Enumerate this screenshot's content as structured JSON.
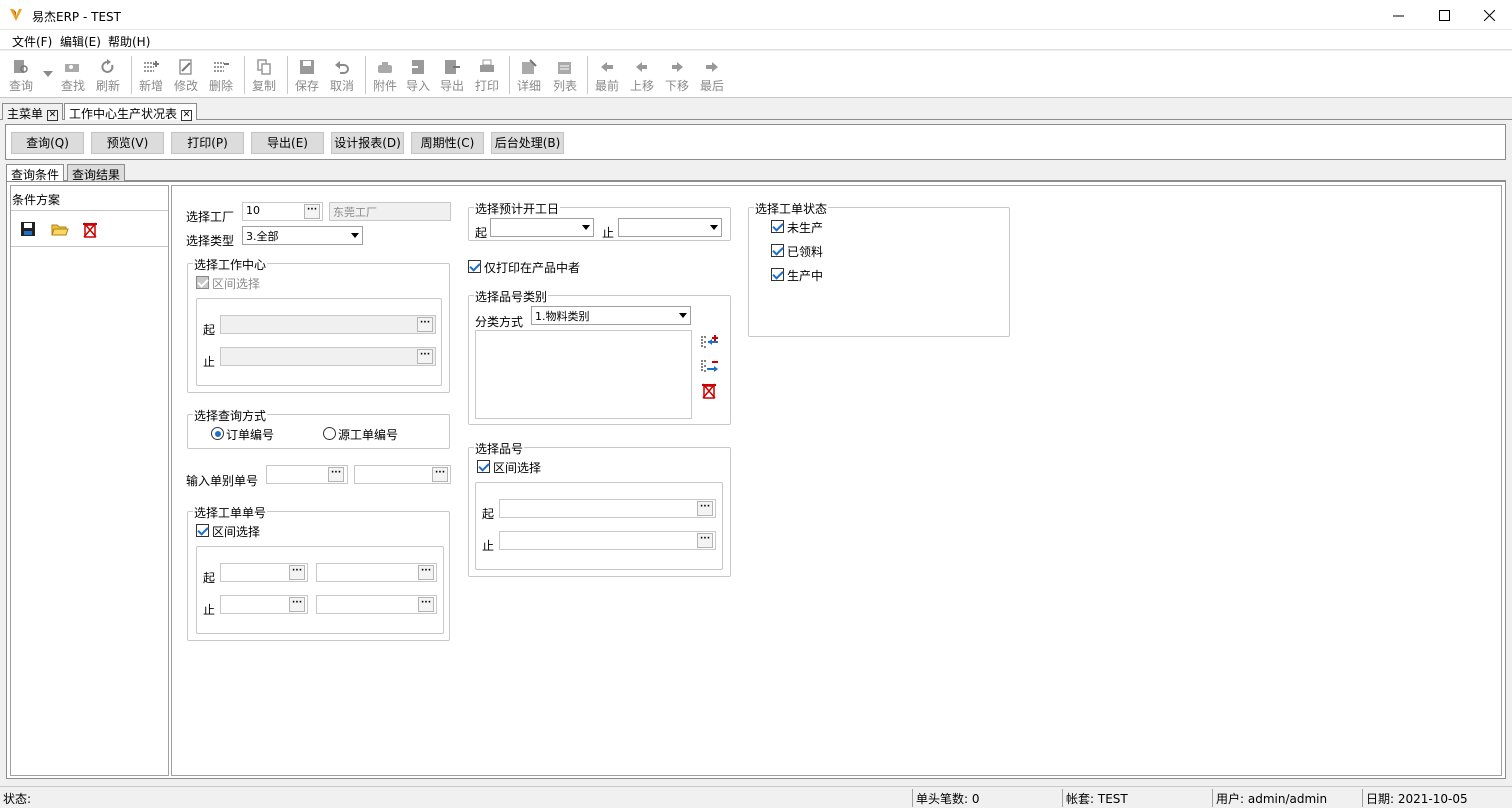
{
  "window": {
    "title": "易杰ERP - TEST"
  },
  "menu": [
    "文件(F)",
    "编辑(E)",
    "帮助(H)"
  ],
  "toolbar": [
    "查询",
    "查找",
    "刷新",
    "新增",
    "修改",
    "删除",
    "复制",
    "保存",
    "取消",
    "附件",
    "导入",
    "导出",
    "打印",
    "详细",
    "列表",
    "最前",
    "上移",
    "下移",
    "最后"
  ],
  "doc_tabs": [
    "主菜单",
    "工作中心生产状况表"
  ],
  "command_buttons": [
    "查询(Q)",
    "预览(V)",
    "打印(P)",
    "导出(E)",
    "设计报表(D)",
    "周期性(C)",
    "后台处理(B)"
  ],
  "sub_tabs": [
    "查询条件",
    "查询结果"
  ],
  "left_panel": {
    "title": "条件方案"
  },
  "form": {
    "factory_label": "选择工厂",
    "factory_code": "10",
    "factory_name": "东莞工厂",
    "type_label": "选择类型",
    "type_value": "3.全部",
    "workcenter": {
      "caption": "选择工作中心",
      "range_label": "区间选择",
      "from_label": "起",
      "to_label": "止"
    },
    "query_mode": {
      "caption": "选择查询方式",
      "opt1": "订单编号",
      "opt2": "源工单编号"
    },
    "doc_no_label": "输入单别单号",
    "wo": {
      "caption": "选择工单单号",
      "range_label": "区间选择",
      "from_label": "起",
      "to_label": "止"
    },
    "start_date": {
      "caption": "选择预计开工日",
      "from_label": "起",
      "to_label": "止"
    },
    "print_only_label": "仅打印在产品中者",
    "item_category": {
      "caption": "选择品号类别",
      "method_label": "分类方式",
      "method_value": "1.物料类别"
    },
    "item": {
      "caption": "选择品号",
      "range_label": "区间选择",
      "from_label": "起",
      "to_label": "止"
    },
    "wo_status": {
      "caption": "选择工单状态",
      "s1": "未生产",
      "s2": "已领料",
      "s3": "生产中"
    }
  },
  "status": {
    "state": "状态:",
    "count": "单头笔数: 0",
    "account": "帐套: TEST",
    "user": "用户: admin/admin",
    "date": "日期: 2021-10-05"
  },
  "colors": {
    "accent": "#1e6fc8",
    "button_bg": "#dcdcdc",
    "logo": "#f0a020"
  }
}
